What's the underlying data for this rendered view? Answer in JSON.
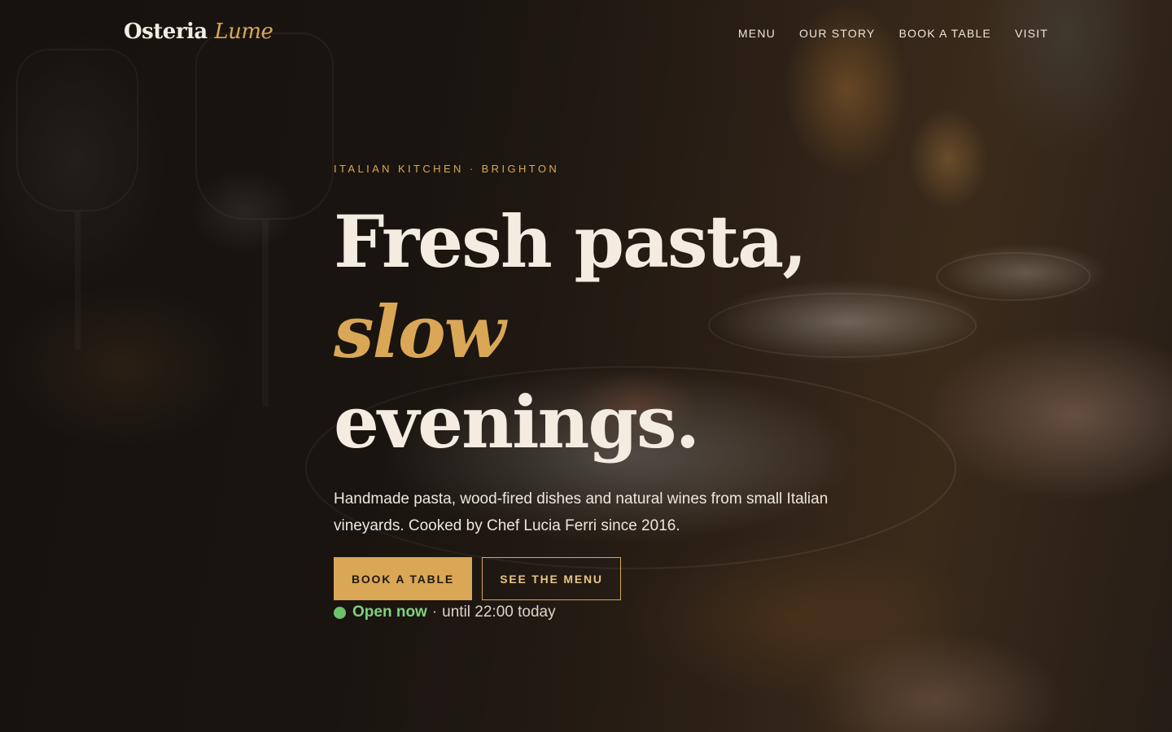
{
  "brand": {
    "name": "Osteria",
    "name_accent": "Lume"
  },
  "nav": {
    "items": [
      {
        "label": "MENU"
      },
      {
        "label": "OUR STORY"
      },
      {
        "label": "BOOK A TABLE"
      },
      {
        "label": "VISIT"
      }
    ]
  },
  "hero": {
    "eyebrow": "ITALIAN KITCHEN · BRIGHTON",
    "headline": {
      "line1": "Fresh pasta,",
      "line2": "slow",
      "line3": "evenings."
    },
    "description": "Handmade pasta, wood-fired dishes and natural wines from small Italian vineyards. Cooked by Chef Lucia Ferri since 2016.",
    "primary_cta": "BOOK A TABLE",
    "secondary_cta": "SEE THE MENU",
    "status": {
      "label": "Open now",
      "separator": "·",
      "detail": "until 22:00 today"
    }
  },
  "colors": {
    "accent": "#d9a756",
    "text_light": "#f4ece1",
    "open_status": "#7fd17c",
    "background": "#1c1713"
  }
}
